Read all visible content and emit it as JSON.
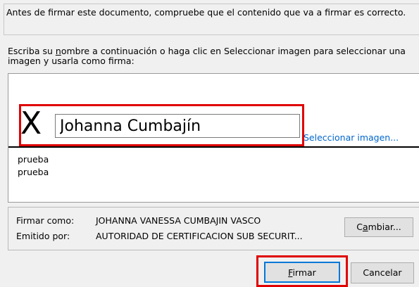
{
  "info": {
    "text": "Antes de firmar este documento, compruebe que el contenido que va a firmar es correcto."
  },
  "instructions": {
    "pre": "Escriba su ",
    "accel": "n",
    "post": "ombre a continuación o haga clic en Seleccionar imagen para seleccionar una imagen y usarla como firma:"
  },
  "signature": {
    "x_mark": "X",
    "name_value": "Johanna Cumbajín",
    "select_image_link": "Seleccionar imagen...",
    "notes": [
      "prueba",
      "prueba"
    ]
  },
  "signer": {
    "sign_as_label": "Firmar como:",
    "sign_as_value": "JOHANNA VANESSA CUMBAJIN VASCO",
    "issued_by_label": "Emitido por:",
    "issued_by_value": "AUTORIDAD DE CERTIFICACION SUB SECURIT...",
    "change_button_pre": "C",
    "change_button_accel": "a",
    "change_button_post": "mbiar..."
  },
  "buttons": {
    "sign_accel": "F",
    "sign_post": "irmar",
    "cancel_label": "Cancelar"
  },
  "colors": {
    "highlight": "#e00000",
    "link": "#0066cc",
    "default_button_border": "#0078d7"
  }
}
